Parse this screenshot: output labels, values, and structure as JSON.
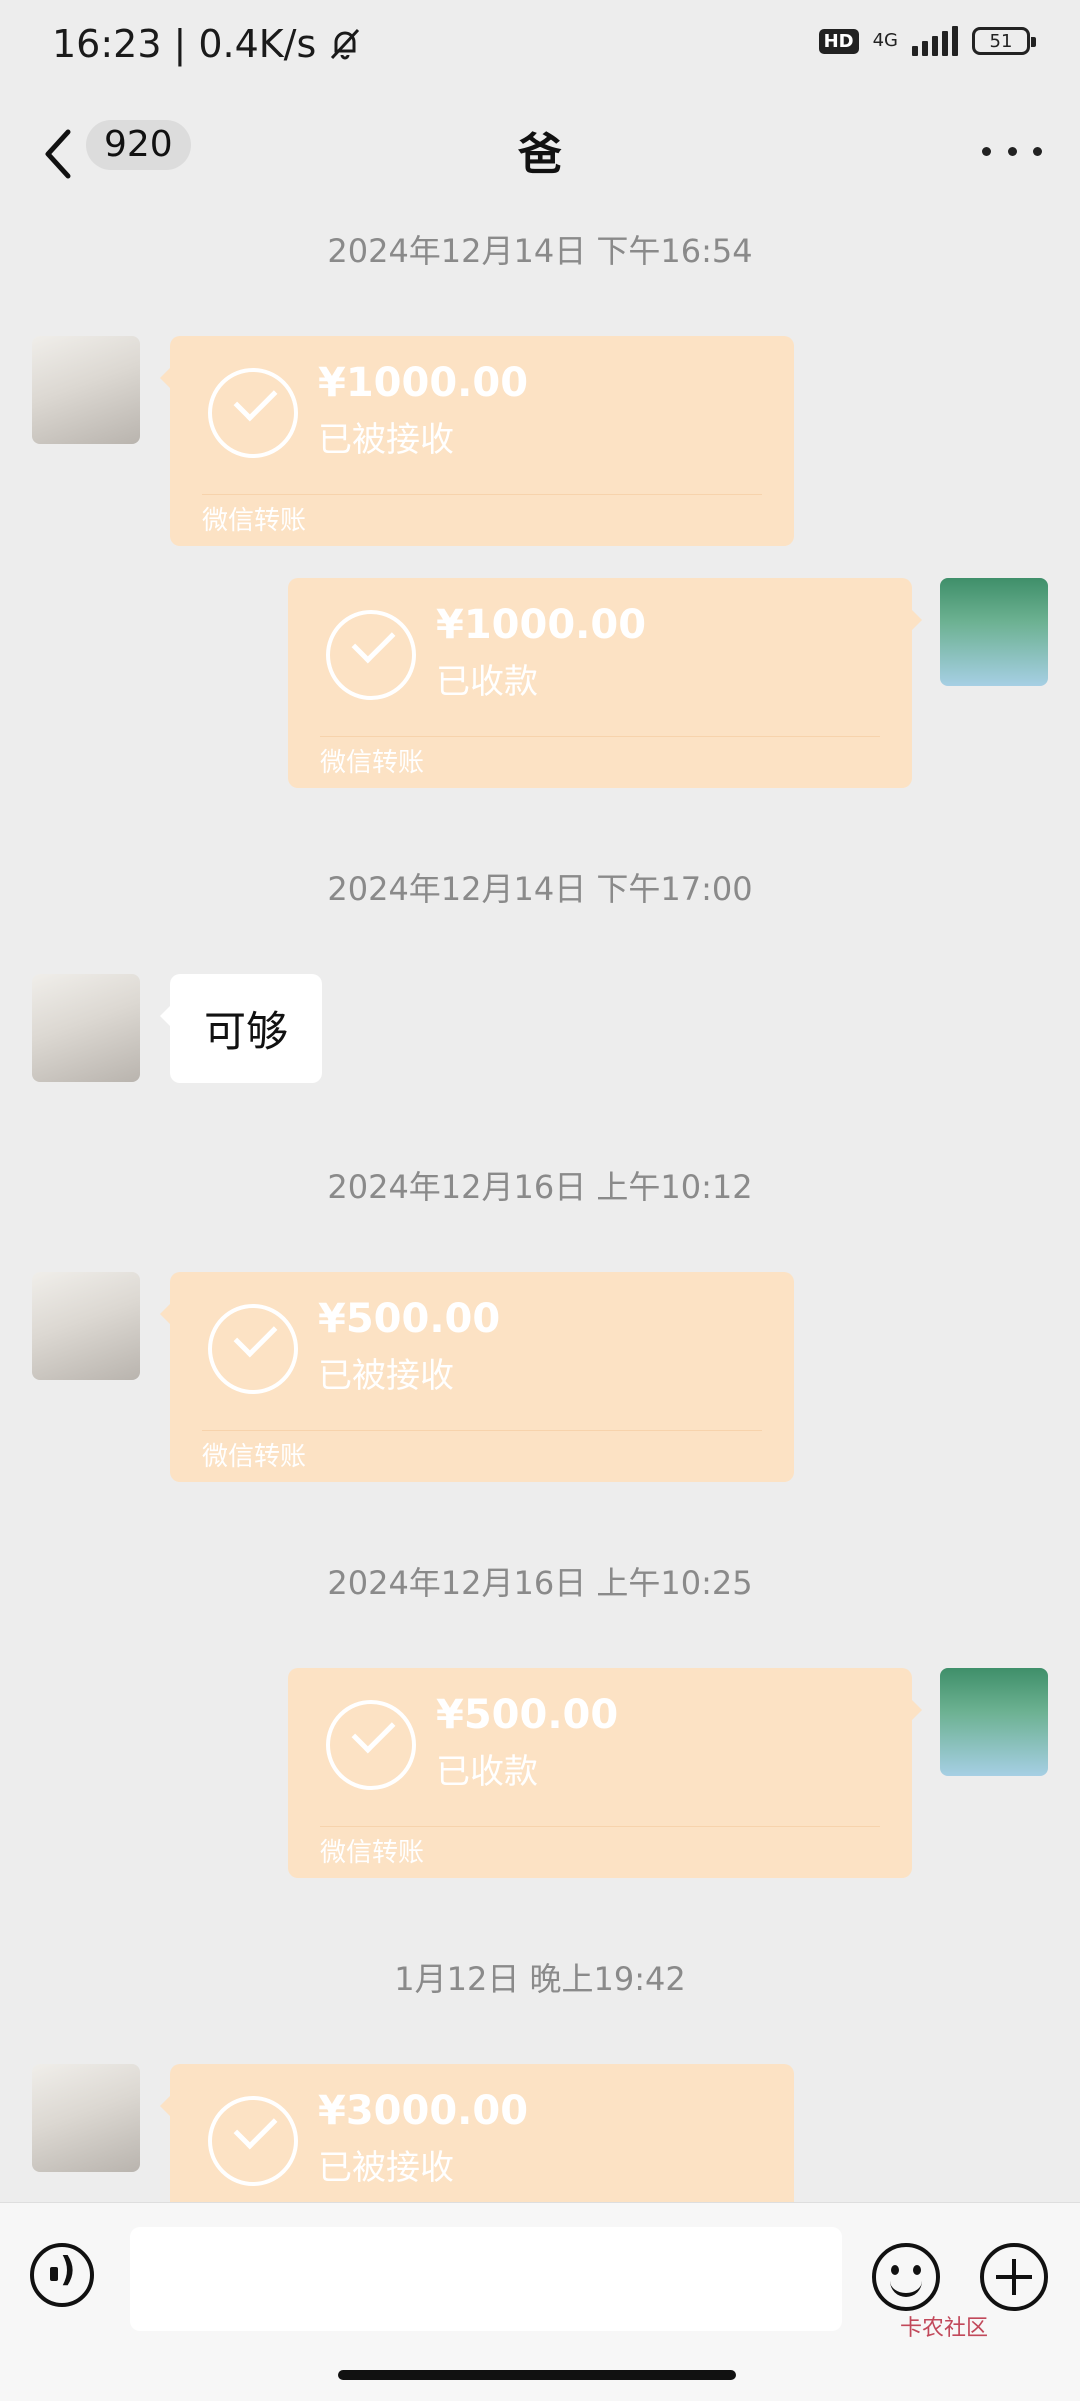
{
  "status_bar": {
    "time": "16:23",
    "separator": "|",
    "network_speed": "0.4K/s",
    "hd": "HD",
    "network_type": "4G",
    "battery": "51"
  },
  "nav": {
    "unread_count": "920",
    "title": "爸"
  },
  "messages": [
    {
      "timestamp": "2024年12月14日 下午16:54"
    },
    {
      "sender": "dad",
      "type": "transfer",
      "amount": "¥1000.00",
      "status": "已被接收",
      "footer": "微信转账"
    },
    {
      "sender": "me",
      "type": "transfer",
      "amount": "¥1000.00",
      "status": "已收款",
      "footer": "微信转账"
    },
    {
      "timestamp": "2024年12月14日 下午17:00"
    },
    {
      "sender": "dad",
      "type": "text",
      "text": "可够"
    },
    {
      "timestamp": "2024年12月16日 上午10:12"
    },
    {
      "sender": "dad",
      "type": "transfer",
      "amount": "¥500.00",
      "status": "已被接收",
      "footer": "微信转账"
    },
    {
      "timestamp": "2024年12月16日 上午10:25"
    },
    {
      "sender": "me",
      "type": "transfer",
      "amount": "¥500.00",
      "status": "已收款",
      "footer": "微信转账"
    },
    {
      "timestamp": "1月12日 晚上19:42"
    },
    {
      "sender": "dad",
      "type": "transfer",
      "amount": "¥3000.00",
      "status": "已被接收"
    }
  ],
  "input": {
    "placeholder": ""
  },
  "watermark": "卡农社区",
  "colors": {
    "transfer_bubble": "#fce2c4",
    "background": "#ededed"
  }
}
